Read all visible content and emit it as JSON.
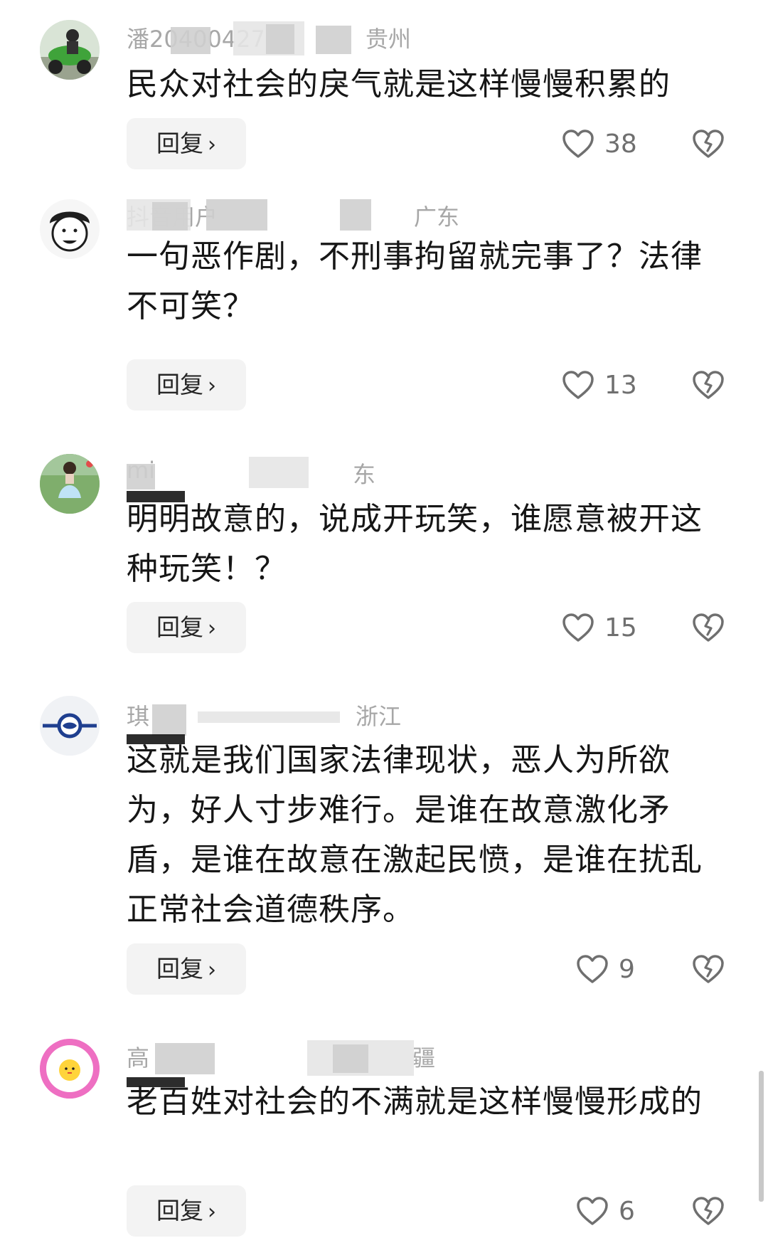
{
  "comments": [
    {
      "username": "潘20400427",
      "region": "贵州",
      "text": "民众对社会的戾气就是这样慢慢积累的",
      "reply_label": "回复",
      "likes": "38",
      "avatar_icon": "avatar-motorcycle-rider"
    },
    {
      "username": "抖音用户",
      "region": "广东",
      "text": "一句恶作剧，不刑事拘留就完事了？法律不可笑？",
      "reply_label": "回复",
      "likes": "13",
      "avatar_icon": "avatar-cartoon-face"
    },
    {
      "username": "mi",
      "region": "东",
      "text": "明明故意的，说成开玩笑，谁愿意被开这种玩笑！？",
      "reply_label": "回复",
      "likes": "15",
      "avatar_icon": "avatar-girl-dress"
    },
    {
      "username": "琪",
      "region": "浙江",
      "text": "这就是我们国家法律现状，恶人为所欲为，好人寸步难行。是谁在故意激化矛盾，是谁在故意在激起民愤，是谁在扰乱正常社会道德秩序。",
      "reply_label": "回复",
      "likes": "9",
      "avatar_icon": "avatar-airplane-logo"
    },
    {
      "username": "高",
      "region": "疆",
      "text": "老百姓对社会的不满就是这样慢慢形成的",
      "reply_label": "回复",
      "likes": "6",
      "avatar_icon": "avatar-fried-egg"
    }
  ],
  "colors": {
    "text": "#161616",
    "meta": "#a7a7a7",
    "reply_bg": "#f3f3f3",
    "icon": "#6f6f6f"
  }
}
